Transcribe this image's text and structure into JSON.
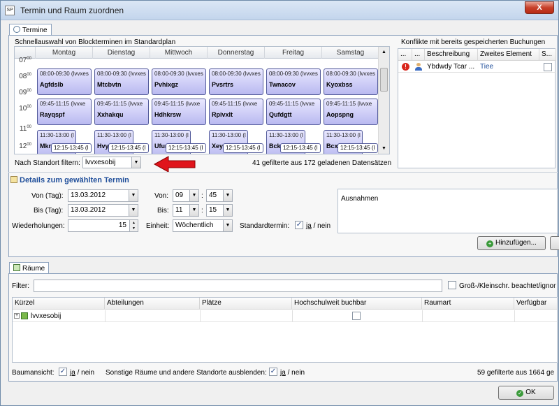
{
  "window": {
    "title": "Termin und Raum zuordnen",
    "app_icon": "SP",
    "close_label": "X"
  },
  "tabs": {
    "termine": "Termine",
    "raeume": "Räume"
  },
  "schnellauswahl": {
    "title": "Schnellauswahl von Blockterminen im Standardplan",
    "days": [
      "Montag",
      "Dienstag",
      "Mittwoch",
      "Donnerstag",
      "Freitag",
      "Samstag"
    ],
    "hours": [
      "07",
      "08",
      "09",
      "10",
      "11",
      "12"
    ],
    "hour_suffix": "00",
    "row1": [
      {
        "time": "08:00-09:30 (lvvxes",
        "name": "Agfdslb"
      },
      {
        "time": "08:00-09:30 (lvvxes",
        "name": "Mtcbvtn"
      },
      {
        "time": "08:00-09:30 (lvvxes",
        "name": "Pvhixgz"
      },
      {
        "time": "08:00-09:30 (lvvxes",
        "name": "Pvsrtrs"
      },
      {
        "time": "08:00-09:30 (lvvxes",
        "name": "Twnacov"
      },
      {
        "time": "08:00-09:30 (lvvxes",
        "name": "Kyoxbss"
      }
    ],
    "row2": [
      {
        "time": "09:45-11:15 (lvvxe",
        "name": "Rayqspf"
      },
      {
        "time": "09:45-11:15 (lvvxe",
        "name": "Xxhakqu"
      },
      {
        "time": "09:45-11:15 (lvvxe",
        "name": "Hdhkrsw"
      },
      {
        "time": "09:45-11:15 (lvvxe",
        "name": "Rpivxlt"
      },
      {
        "time": "09:45-11:15 (lvvxe",
        "name": "Qufdgtt"
      },
      {
        "time": "09:45-11:15 (lvvxe",
        "name": "Aopspng"
      }
    ],
    "row3": [
      {
        "time": "11:30-13:00 (l",
        "name": "Mkr",
        "overlap": "12:15-13:45 (l"
      },
      {
        "time": "11:30-13:00 (l",
        "name": "Hvy",
        "overlap": "12:15-13:45 (l"
      },
      {
        "time": "11:30-13:00 (l",
        "name": "Ufur",
        "overlap": "12:15-13:45 (l"
      },
      {
        "time": "11:30-13:00 (l",
        "name": "Xey",
        "overlap": "12:15-13:45 (l"
      },
      {
        "time": "11:30-13:00 (l",
        "name": "Bck",
        "overlap": "12:15-13:45 (l"
      },
      {
        "time": "11:30-13:00 (l",
        "name": "Bcx",
        "overlap": "12:15-13:45 (l"
      }
    ],
    "filter_label": "Nach Standort filtern:",
    "filter_value": "lvvxesobij",
    "count_text": "41 gefilterte aus 172 geladenen Datensätzen"
  },
  "konflikte": {
    "title": "Konflikte mit bereits gespeicherten Buchungen",
    "columns": [
      "...",
      "...",
      "Beschreibung",
      "Zweites Element",
      "S..."
    ],
    "row": {
      "beschreibung": "Ybdwdy Tcar ...",
      "zweites": "Tiee"
    }
  },
  "details": {
    "title": "Details zum gewählten Termin",
    "von_tag_label": "Von (Tag):",
    "von_tag_value": "13.03.2012",
    "bis_tag_label": "Bis (Tag):",
    "bis_tag_value": "13.03.2012",
    "wiederholungen_label": "Wiederholungen:",
    "wiederholungen_value": "15",
    "von_label": "Von:",
    "von_h": "09",
    "von_m": "45",
    "bis_label": "Bis:",
    "bis_h": "11",
    "bis_m": "15",
    "colon": ":",
    "einheit_label": "Einheit:",
    "einheit_value": "Wöchentlich",
    "standardtermin_label": "Standardtermin:",
    "ja": "ja",
    "sep": "/",
    "nein": "nein",
    "ausnahmen_label": "Ausnahmen",
    "hinzufuegen_label": "Hinzufügen..."
  },
  "raeume": {
    "filter_label": "Filter:",
    "gross_klein_label": "Groß-/Kleinschr. beachtet/ignor",
    "columns": [
      "Kürzel",
      "Abteilungen",
      "Plätze",
      "Hochschulweit buchbar",
      "Raumart",
      "Verfügbar"
    ],
    "row": {
      "kuerzel": "lvvxesobij"
    },
    "baumansicht_label": "Baumansicht:",
    "sonstige_label": "Sonstige Räume und andere Standorte ausblenden:",
    "count_text": "59 gefilterte aus 1664 ge"
  },
  "ok_label": "OK",
  "colors": {
    "accent": "#1f4e9a",
    "arrow": "#e0141b",
    "appt_border": "#525a9a"
  }
}
